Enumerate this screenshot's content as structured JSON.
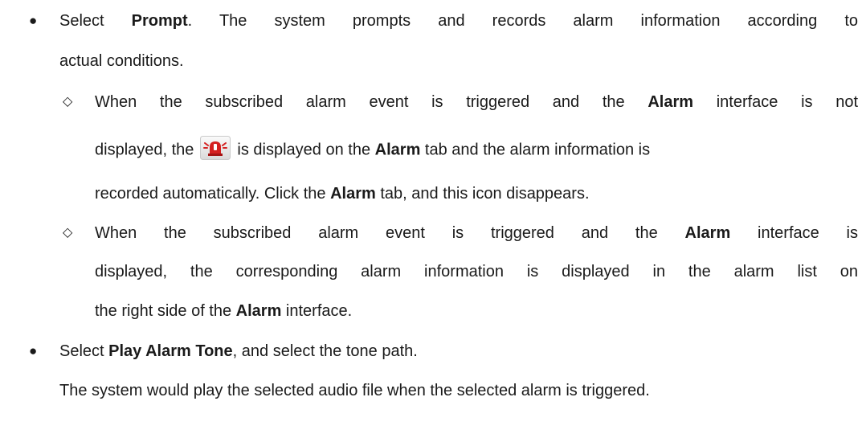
{
  "bullets": {
    "prompt": {
      "pre": "Select ",
      "bold": "Prompt",
      "post": ". The system prompts and records alarm information according to",
      "line2": "actual conditions."
    },
    "sub1": {
      "l1_pre": "When the subscribed alarm event is triggered and the ",
      "l1_bold": "Alarm",
      "l1_post": " interface is not",
      "l2_pre": "displayed, the",
      "l2_mid": "is displayed on the ",
      "l2_bold": "Alarm",
      "l2_post": " tab and the alarm information is",
      "l3_pre": "recorded automatically. Click the ",
      "l3_bold": "Alarm",
      "l3_post": " tab, and this icon disappears."
    },
    "sub2": {
      "l1_pre": "When the subscribed alarm event is triggered and the ",
      "l1_bold": "Alarm",
      "l1_post": " interface is",
      "l2": "displayed, the corresponding alarm information is displayed in the alarm list on",
      "l3_pre": "the right side of the ",
      "l3_bold": "Alarm",
      "l3_post": " interface."
    },
    "tone": {
      "pre": "Select ",
      "bold": "Play Alarm Tone",
      "post": ", and select the tone path.",
      "line2": "The system would play the selected audio file when the selected alarm is triggered."
    }
  },
  "symbols": {
    "bullet": "●",
    "diamond": "◇"
  },
  "icons": {
    "alarm": "alarm-siren-icon"
  },
  "colors": {
    "text": "#1a1a1a",
    "icon_red": "#d42020",
    "icon_frame": "#c9c9c9"
  }
}
